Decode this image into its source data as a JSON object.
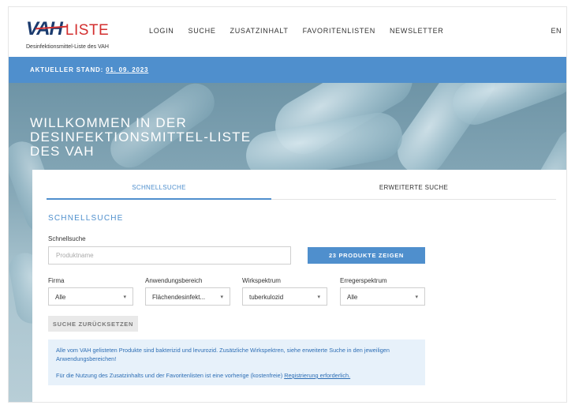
{
  "header": {
    "logo_vah": "VAH",
    "logo_liste": "LISTE",
    "logo_subtitle": "Desinfektionsmittel-Liste des VAH",
    "nav": [
      "LOGIN",
      "SUCHE",
      "ZUSATZINHALT",
      "FAVORITENLISTEN",
      "NEWSLETTER"
    ],
    "lang": "EN"
  },
  "status": {
    "prefix": "AKTUELLER STAND:",
    "date": "01. 09. 2023"
  },
  "hero": {
    "title": "WILLKOMMEN IN DER DESINFEKTIONSMITTEL-LISTE DES VAH"
  },
  "tabs": {
    "quick": "SCHNELLSUCHE",
    "advanced": "ERWEITERTE SUCHE"
  },
  "search": {
    "section_title": "SCHNELLSUCHE",
    "label": "Schnellsuche",
    "placeholder": "Produktname",
    "value": "",
    "submit_label": "23 PRODUKTE ZEIGEN"
  },
  "filters": [
    {
      "label": "Firma",
      "value": "Alle"
    },
    {
      "label": "Anwendungsbereich",
      "value": "Flächendesinfekt..."
    },
    {
      "label": "Wirkspektrum",
      "value": "tuberkulozid"
    },
    {
      "label": "Erregerspektrum",
      "value": "Alle"
    }
  ],
  "reset_label": "SUCHE ZURÜCKSETZEN",
  "info": {
    "line1": "Alle vom VAH gelisteten Produkte sind bakterizid und levurozid. Zusätzliche Wirkspektren, siehe erweiterte Suche in den jeweiligen Anwendungsbereichen!",
    "line2_prefix": "Für die Nutzung des Zusatzinhalts und der Favoritenlisten ist eine vorherige (kostenfreie) ",
    "link_label": "Registrierung erforderlich."
  },
  "colors": {
    "accent": "#4f8fcd",
    "logo_red": "#d32f2f",
    "logo_navy": "#1b3b6e",
    "info_bg": "#e7f1fa"
  }
}
